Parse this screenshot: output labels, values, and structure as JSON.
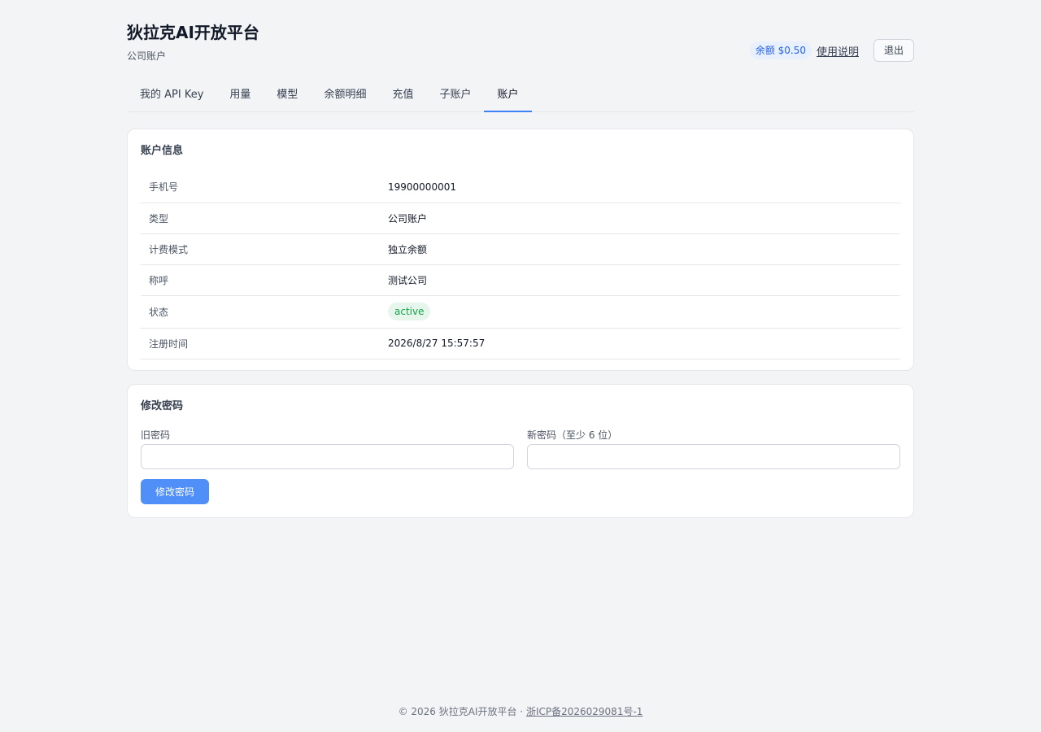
{
  "header": {
    "title": "狄拉克AI开放平台",
    "subtitle": "公司账户",
    "balance_badge": "余额 $0.50",
    "help_link": "使用说明",
    "logout_label": "退出"
  },
  "tabs": [
    {
      "label": "我的 API Key"
    },
    {
      "label": "用量"
    },
    {
      "label": "模型"
    },
    {
      "label": "余额明细"
    },
    {
      "label": "充值"
    },
    {
      "label": "子账户"
    },
    {
      "label": "账户",
      "active": true
    }
  ],
  "account_info": {
    "title": "账户信息",
    "rows": [
      {
        "label": "手机号",
        "value": "19900000001"
      },
      {
        "label": "类型",
        "value": "公司账户"
      },
      {
        "label": "计费模式",
        "value": "独立余额"
      },
      {
        "label": "称呼",
        "value": "测试公司"
      },
      {
        "label": "状态",
        "value": "active"
      },
      {
        "label": "注册时间",
        "value": "2026/8/27 15:57:57"
      }
    ]
  },
  "change_password": {
    "title": "修改密码",
    "old_password_label": "旧密码",
    "old_password_value": "",
    "new_password_label": "新密码（至少 6 位）",
    "new_password_value": "",
    "submit_label": "修改密码"
  },
  "footer": {
    "copyright": "© 2026 狄拉克AI开放平台 · ",
    "icp": "浙ICP备2026029081号-1"
  },
  "colors": {
    "accent": "#3b82f6",
    "primary_button": "#4f8ff7",
    "status_active": "#16a34a",
    "background": "#f3f4f6"
  }
}
